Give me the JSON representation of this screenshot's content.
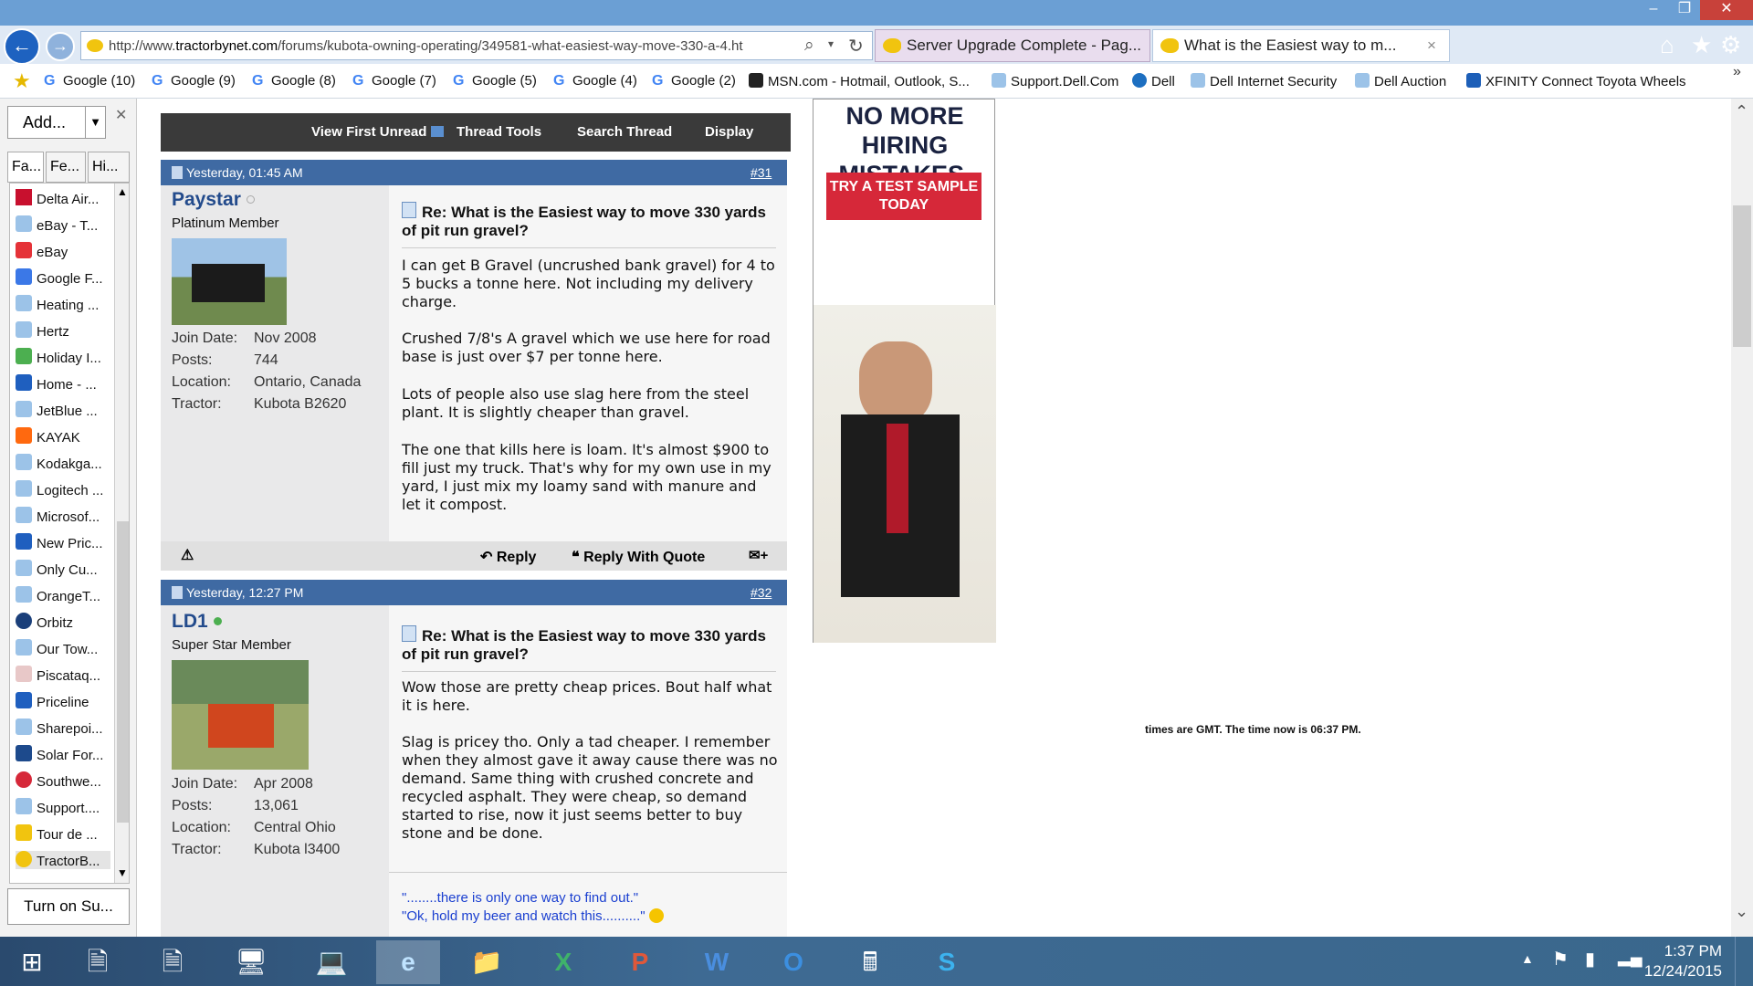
{
  "browser": {
    "url_prefix": "http://www.",
    "url_domain": "tractorbynet.com",
    "url_path": "/forums/kubota-owning-operating/349581-what-easiest-way-move-330-a-4.ht",
    "tabs": [
      {
        "label": "Server Upgrade Complete - Pag..."
      },
      {
        "label": "What is the Easiest way to m..."
      }
    ],
    "tab_close": "×"
  },
  "favorites_bar": [
    "Google (10)",
    "Google (9)",
    "Google (8)",
    "Google (7)",
    "Google (5)",
    "Google (4)",
    "Google (2)",
    "MSN.com - Hotmail, Outlook, S...",
    "Support.Dell.Com",
    "Dell",
    "Dell Internet Security",
    "Dell Auction",
    "XFINITY Connect Toyota Wheels"
  ],
  "sidebar": {
    "add_label": "Add...",
    "tabs": [
      "Fa...",
      "Fe...",
      "Hi..."
    ],
    "items": [
      "Delta Air...",
      "eBay - T...",
      "eBay",
      "Google F...",
      "Heating ...",
      "Hertz",
      "Holiday I...",
      "Home - ...",
      "JetBlue ...",
      "KAYAK",
      "Kodakga...",
      "Logitech ...",
      "Microsof...",
      "New Pric...",
      "Only Cu...",
      "OrangeT...",
      "Orbitz",
      "Our Tow...",
      "Piscataq...",
      "Priceline",
      "Sharepoi...",
      "Solar For...",
      "Southwe...",
      "Support....",
      "Tour de ...",
      "TractorB..."
    ],
    "turn_on": "Turn on Su..."
  },
  "thread_toolbar": [
    "View First Unread",
    "Thread Tools",
    "Search Thread",
    "Display"
  ],
  "posts": [
    {
      "date": "Yesterday, 01:45 AM",
      "num": "#31",
      "user": "Paystar",
      "title": "Platinum Member",
      "join_label": "Join Date:",
      "join": "Nov 2008",
      "posts_label": "Posts:",
      "posts": "744",
      "loc_label": "Location:",
      "loc": "Ontario, Canada",
      "tractor_label": "Tractor:",
      "tractor": "Kubota B2620",
      "post_title": "Re: What is the Easiest way to move 330 yards of pit run gravel?",
      "paragraphs": [
        "I can get B Gravel (uncrushed bank gravel) for 4 to 5 bucks a tonne here. Not including my delivery charge.",
        "Crushed 7/8's A gravel which we use here for road base is just over $7 per tonne here.",
        "Lots of people also use slag here from the steel plant. It is slightly cheaper than gravel.",
        "The one that kills here is loam. It's almost $900 to fill just my truck. That's why for my own use in my yard, I just mix my loamy sand with manure and let it compost."
      ]
    },
    {
      "date": "Yesterday, 12:27 PM",
      "num": "#32",
      "user": "LD1",
      "title": "Super Star Member",
      "join_label": "Join Date:",
      "join": "Apr 2008",
      "posts_label": "Posts:",
      "posts": "13,061",
      "loc_label": "Location:",
      "loc": "Central Ohio",
      "tractor_label": "Tractor:",
      "tractor": "Kubota l3400",
      "post_title": "Re: What is the Easiest way to move 330 yards of pit run gravel?",
      "paragraphs": [
        "Wow those are pretty cheap prices. Bout half what it is here.",
        "Slag is pricey tho. Only a tad cheaper. I remember when they almost gave it away cause there was no demand. Same thing with crushed concrete and recycled asphalt. They were cheap, so demand started to rise, now it just seems better to buy stone and be done."
      ],
      "sig1": "\"........there is only one way to find out.\"",
      "sig2": "\"Ok, hold my beer and watch this..........\""
    }
  ],
  "actions": {
    "reply": "Reply",
    "quote": "Reply With Quote"
  },
  "ad": {
    "headline": "NO MORE HIRING MISTAKES.",
    "button": "TRY A TEST SAMPLE TODAY"
  },
  "footer": {
    "pre": "times are GMT. The time now is ",
    "time": "06:37 PM",
    "post": "."
  },
  "taskbar": {
    "time": "1:37 PM",
    "date": "12/24/2015"
  }
}
